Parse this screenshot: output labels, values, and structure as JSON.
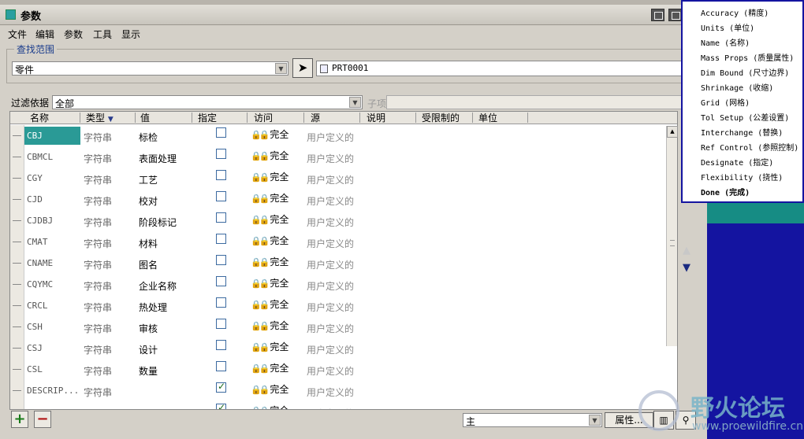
{
  "window": {
    "title": "参数"
  },
  "menu": [
    "文件",
    "编辑",
    "参数",
    "工具",
    "显示"
  ],
  "lookup": {
    "legend": "查找范围",
    "scope_value": "零件",
    "part_name": "PRT0001"
  },
  "filter": {
    "label": "过滤依据",
    "value": "全部",
    "sub_label": "子项"
  },
  "table": {
    "columns": [
      "名称",
      "类型",
      "值",
      "指定",
      "访问",
      "源",
      "说明",
      "受限制的",
      "单位"
    ],
    "rows": [
      {
        "name": "CBJ",
        "type": "字符串",
        "value": "标检",
        "designated": false,
        "access": "完全",
        "source": "用户定义的",
        "selected": true
      },
      {
        "name": "CBMCL",
        "type": "字符串",
        "value": "表面处理",
        "designated": false,
        "access": "完全",
        "source": "用户定义的"
      },
      {
        "name": "CGY",
        "type": "字符串",
        "value": "工艺",
        "designated": false,
        "access": "完全",
        "source": "用户定义的"
      },
      {
        "name": "CJD",
        "type": "字符串",
        "value": "校对",
        "designated": false,
        "access": "完全",
        "source": "用户定义的"
      },
      {
        "name": "CJDBJ",
        "type": "字符串",
        "value": "阶段标记",
        "designated": false,
        "access": "完全",
        "source": "用户定义的"
      },
      {
        "name": "CMAT",
        "type": "字符串",
        "value": "材料",
        "designated": false,
        "access": "完全",
        "source": "用户定义的"
      },
      {
        "name": "CNAME",
        "type": "字符串",
        "value": "图名",
        "designated": false,
        "access": "完全",
        "source": "用户定义的"
      },
      {
        "name": "CQYMC",
        "type": "字符串",
        "value": "企业名称",
        "designated": false,
        "access": "完全",
        "source": "用户定义的"
      },
      {
        "name": "CRCL",
        "type": "字符串",
        "value": "热处理",
        "designated": false,
        "access": "完全",
        "source": "用户定义的"
      },
      {
        "name": "CSH",
        "type": "字符串",
        "value": "审核",
        "designated": false,
        "access": "完全",
        "source": "用户定义的"
      },
      {
        "name": "CSJ",
        "type": "字符串",
        "value": "设计",
        "designated": false,
        "access": "完全",
        "source": "用户定义的"
      },
      {
        "name": "CSL",
        "type": "字符串",
        "value": "数量",
        "designated": false,
        "access": "完全",
        "source": "用户定义的"
      },
      {
        "name": "DESCRIP...",
        "type": "字符串",
        "value": "",
        "designated": true,
        "access": "完全",
        "source": "用户定义的"
      },
      {
        "name": "",
        "type": "",
        "value": "",
        "designated": true,
        "access": "完全",
        "source": "用户定义的"
      }
    ]
  },
  "bottom": {
    "main_select": "主",
    "props_button": "属性..."
  },
  "menu_panel": {
    "items": [
      "Accuracy (精度)",
      "Units (单位)",
      "Name (名称)",
      "Mass Props (质量属性)",
      "Dim Bound (尺寸边界)",
      "Shrinkage (收缩)",
      "Grid (网格)",
      "Tol Setup (公差设置)",
      "Interchange (替换)",
      "Ref Control (参照控制)",
      "Designate (指定)",
      "Flexibility (挠性)",
      "Done (完成)"
    ]
  },
  "watermark": {
    "text": "野火论坛",
    "url": "www.proewildfire.cn"
  },
  "colors": {
    "selection": "#2a9a96",
    "menu_border": "#1414a0",
    "teal": "#168c84"
  }
}
